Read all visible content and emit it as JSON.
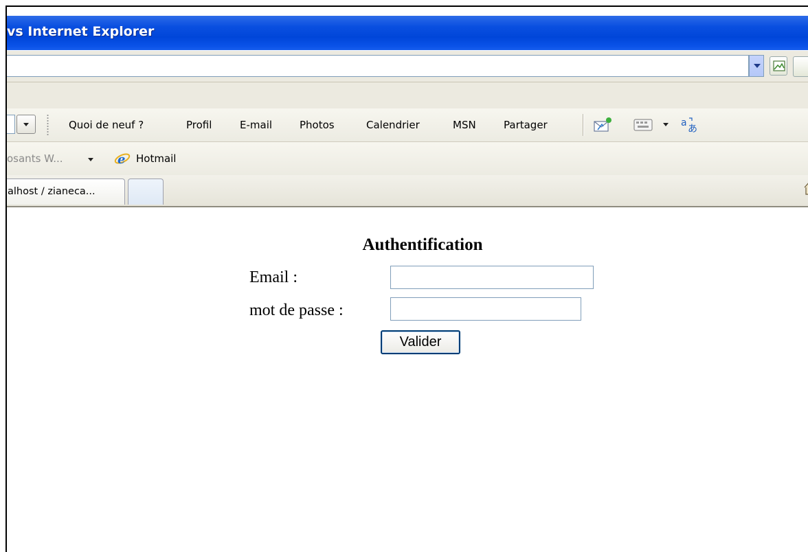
{
  "window": {
    "title": "vs Internet Explorer"
  },
  "address_bar": {
    "url": ""
  },
  "msn_toolbar": {
    "items": [
      {
        "id": "quoi-de-neuf",
        "label": "Quoi de neuf ?"
      },
      {
        "id": "profil",
        "label": "Profil"
      },
      {
        "id": "e-mail",
        "label": "E-mail"
      },
      {
        "id": "photos",
        "label": "Photos"
      },
      {
        "id": "calendrier",
        "label": "Calendrier"
      },
      {
        "id": "msn",
        "label": "MSN"
      },
      {
        "id": "partager",
        "label": "Partager"
      }
    ],
    "icons": [
      "send-mail-icon",
      "keyboard-icon",
      "translate-icon"
    ]
  },
  "links_bar": {
    "truncated_item": "osants W...",
    "hotmail_label": "Hotmail"
  },
  "tabs": {
    "active_label": "alhost / zianeca..."
  },
  "form": {
    "title": "Authentification",
    "email_label": "Email :",
    "password_label": "mot de passe :",
    "email_value": "",
    "password_value": "",
    "submit_label": "Valider"
  },
  "colors": {
    "titlebar": "#0046d9",
    "chrome": "#eceae0",
    "button_border": "#003c74",
    "input_border": "#7f9db9"
  }
}
